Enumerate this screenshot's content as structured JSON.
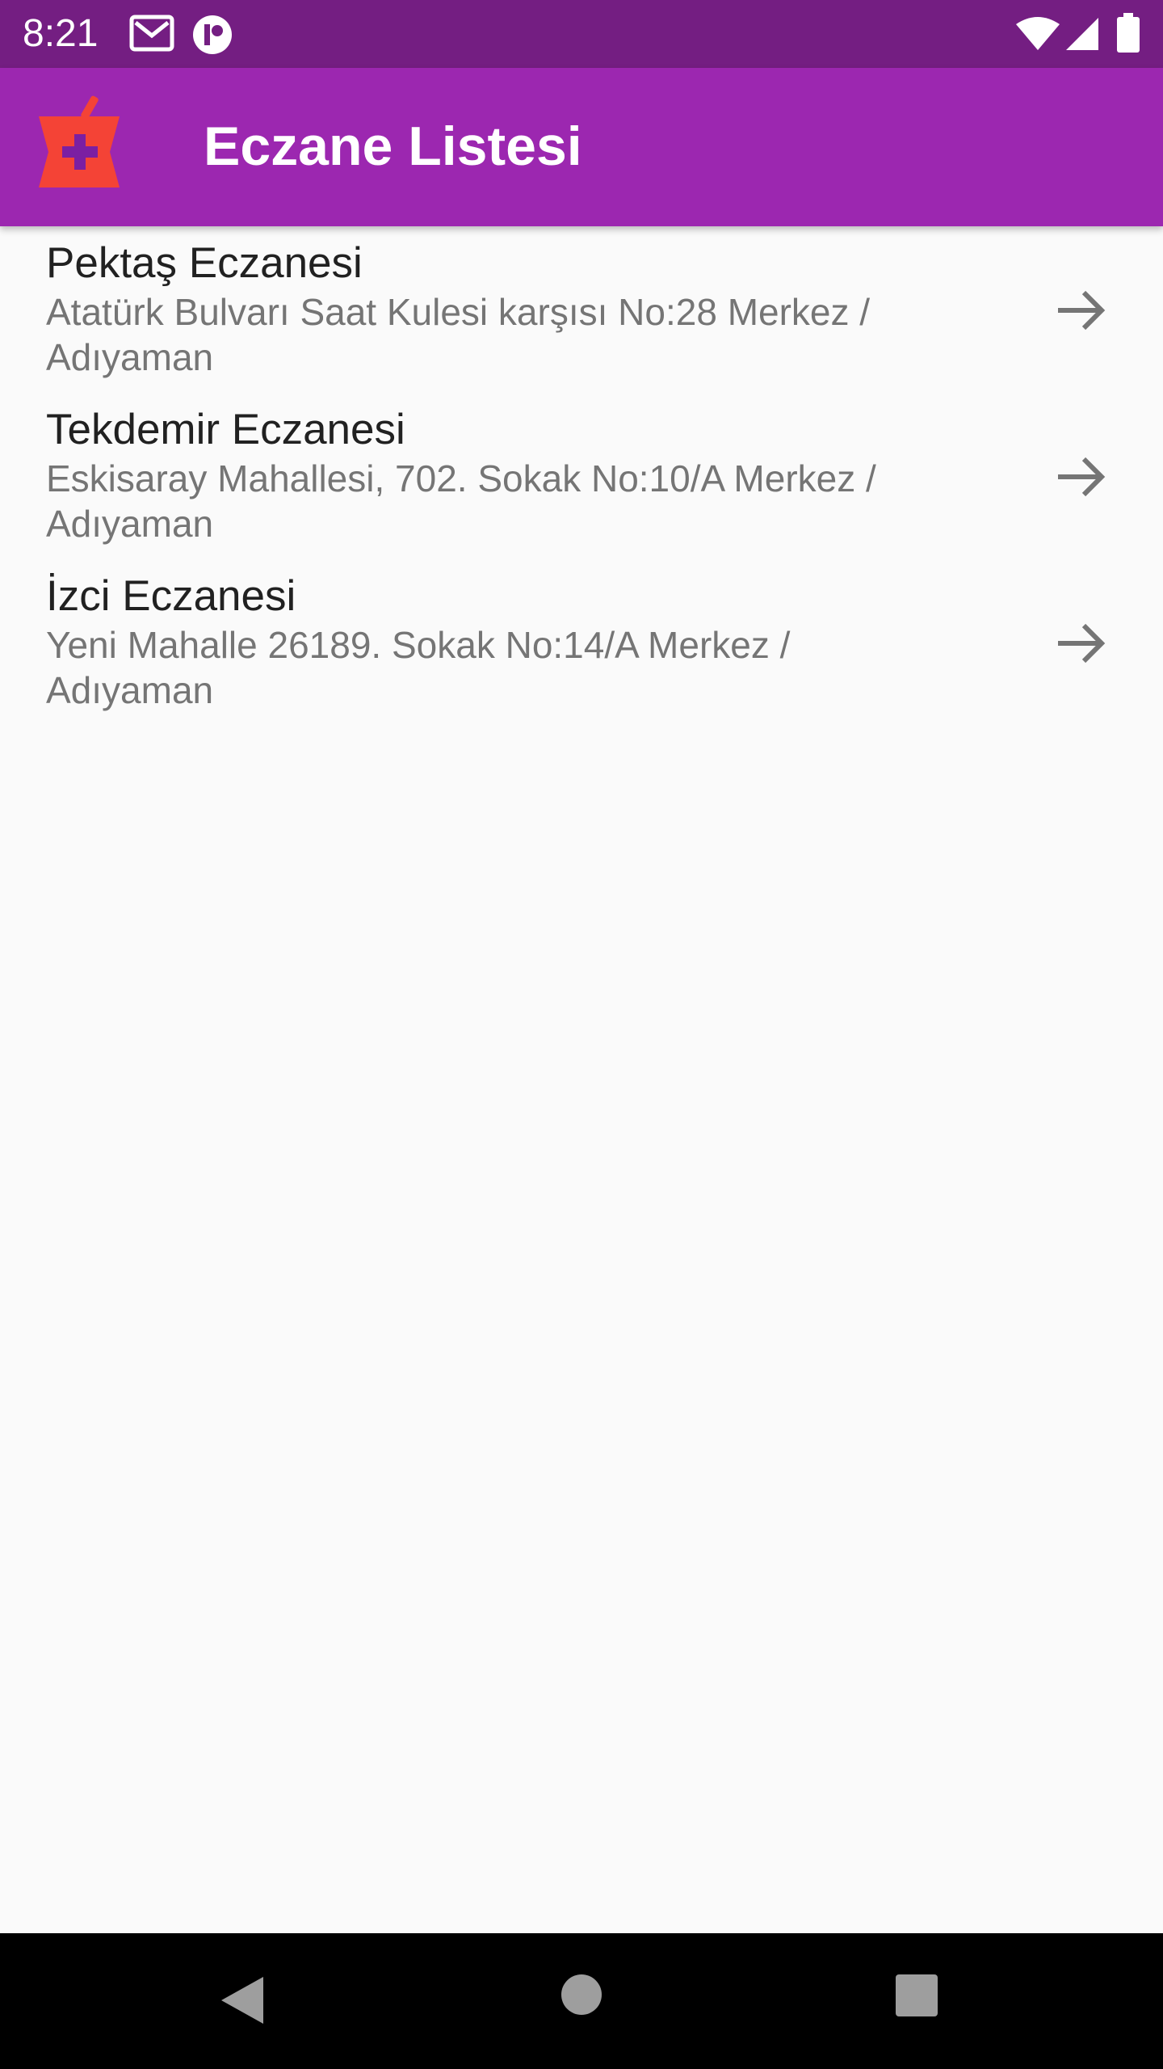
{
  "status_bar": {
    "time": "8:21",
    "icons": [
      "gmail-icon",
      "app-notification-icon",
      "wifi-icon",
      "signal-icon",
      "battery-icon"
    ],
    "background": "#741e82"
  },
  "app_bar": {
    "title": "Eczane Listesi",
    "logo_icon": "pharmacy-mortar-icon",
    "background": "#9c27b0"
  },
  "pharmacies": [
    {
      "name": "Pektaş Eczanesi",
      "address": "Atatürk Bulvarı Saat Kulesi karşısı No:28 Merkez / Adıyaman"
    },
    {
      "name": "Tekdemir Eczanesi",
      "address": "Eskisaray Mahallesi, 702. Sokak No:10/A Merkez / Adıyaman"
    },
    {
      "name": "İzci Eczanesi",
      "address": "Yeni Mahalle 26189. Sokak No:14/A Merkez / Adıyaman"
    }
  ],
  "list_item_icon": "arrow-right-icon",
  "nav_bar": {
    "buttons": [
      "back-icon",
      "home-icon",
      "recents-icon"
    ]
  }
}
